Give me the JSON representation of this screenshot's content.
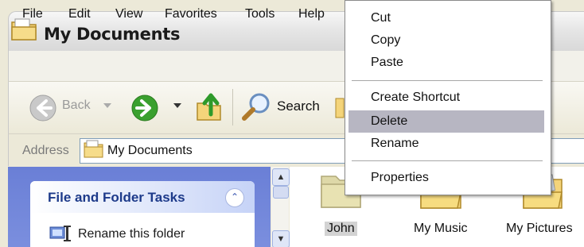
{
  "window": {
    "title": "My Documents"
  },
  "menubar": {
    "items": [
      "File",
      "Edit",
      "View",
      "Favorites",
      "Tools",
      "Help"
    ]
  },
  "toolbar": {
    "back_label": "Back",
    "search_label": "Search"
  },
  "address": {
    "label": "Address",
    "value": "My Documents"
  },
  "task_pane": {
    "header": "File and Folder Tasks",
    "items": [
      {
        "label": "Rename this folder",
        "icon": "rename-folder-icon"
      }
    ]
  },
  "files": [
    {
      "label": "John",
      "icon": "folder-icon",
      "selected": true
    },
    {
      "label": "My Music",
      "icon": "music-folder-icon",
      "selected": false
    },
    {
      "label": "My Pictures",
      "icon": "pictures-folder-icon",
      "selected": false
    }
  ],
  "context_menu": {
    "items": [
      "Cut",
      "Copy",
      "Paste",
      "Create Shortcut",
      "Delete",
      "Rename",
      "Properties"
    ],
    "highlighted": "Delete"
  },
  "colors": {
    "task_pane_bg": "#6a7fd6",
    "task_header_text": "#1d3a8a",
    "menu_highlight": "#b7b6c2",
    "go_arrow": "#3aa02e"
  }
}
